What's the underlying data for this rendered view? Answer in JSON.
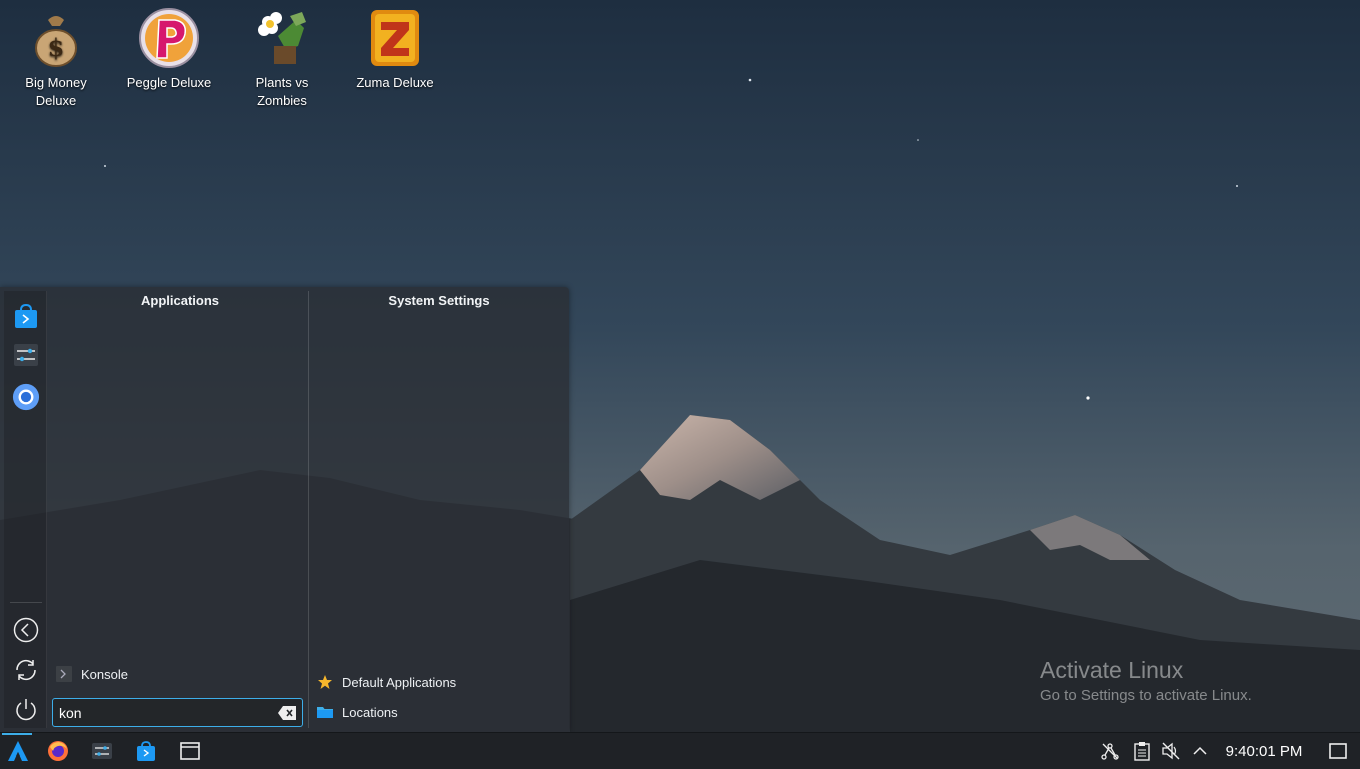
{
  "desktop": {
    "icons": [
      {
        "label": "Big Money\nDeluxe",
        "icon": "money-bag-icon"
      },
      {
        "label": "Peggle Deluxe",
        "icon": "peggle-icon"
      },
      {
        "label": "Plants vs\nZombies",
        "icon": "plants-vs-zombies-icon"
      },
      {
        "label": "Zuma Deluxe",
        "icon": "zuma-icon"
      }
    ]
  },
  "launcher": {
    "sidebar": {
      "favorites": [
        "discover-icon",
        "system-settings-icon",
        "chromium-icon"
      ],
      "bottom": [
        "logout-icon",
        "restart-icon",
        "shutdown-icon"
      ]
    },
    "applications": {
      "header": "Applications",
      "results": [
        {
          "label": "Konsole",
          "icon": "konsole-icon"
        }
      ]
    },
    "system_settings": {
      "header": "System Settings",
      "results": [
        {
          "label": "Default Applications",
          "icon": "star-icon"
        },
        {
          "label": "Locations",
          "icon": "folder-icon"
        }
      ]
    },
    "search": {
      "value": "kon",
      "placeholder": ""
    }
  },
  "watermark": {
    "title": "Activate Linux",
    "subtitle": "Go to Settings to activate Linux."
  },
  "taskbar": {
    "launchers": [
      "application-launcher-icon",
      "firefox-icon",
      "system-settings-icon",
      "discover-icon",
      "file-manager-icon"
    ],
    "tray": [
      "network-icon",
      "clipboard-icon",
      "volume-muted-icon",
      "expand-tray-icon"
    ],
    "clock": "9:40:01 PM",
    "show_desktop": "show-desktop-icon"
  },
  "colors": {
    "accent": "#3daee9",
    "panel": "#1f2226"
  }
}
